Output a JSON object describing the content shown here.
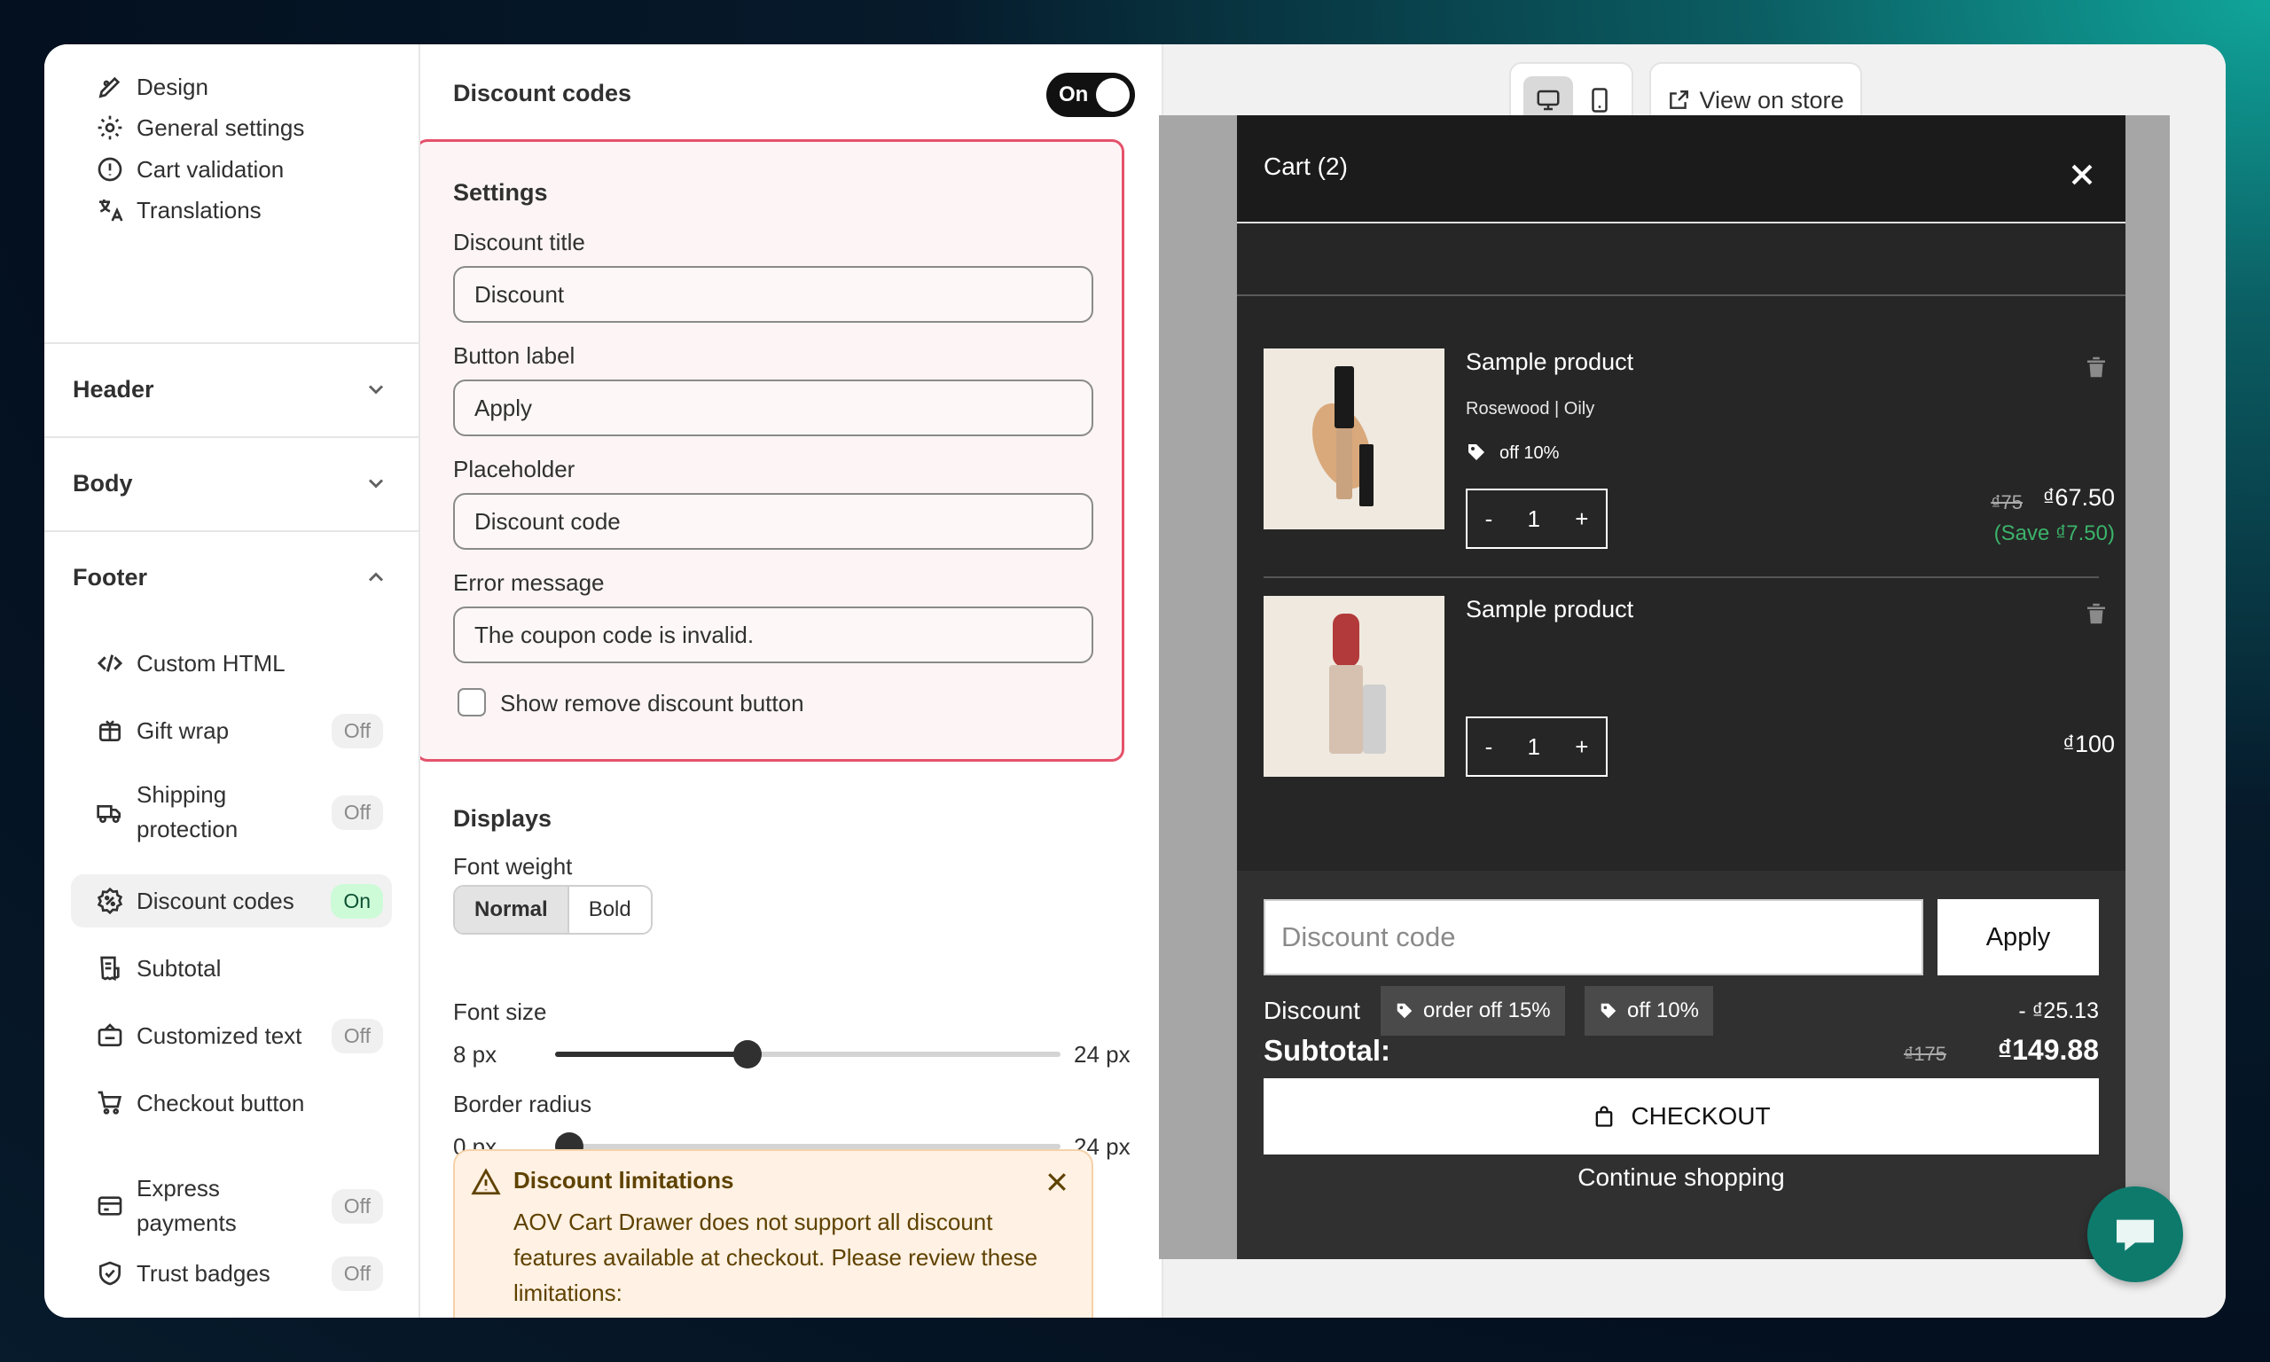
{
  "sidebar": {
    "items_top": [
      {
        "label": "Design",
        "icon": "design-icon"
      },
      {
        "label": "General settings",
        "icon": "gear-icon"
      },
      {
        "label": "Cart validation",
        "icon": "alert-circle-icon"
      },
      {
        "label": "Translations",
        "icon": "translate-icon"
      }
    ],
    "sections": {
      "header": "Header",
      "body": "Body",
      "footer": "Footer"
    },
    "footer_items": [
      {
        "label": "Custom HTML",
        "badge": ""
      },
      {
        "label": "Gift wrap",
        "badge": "Off"
      },
      {
        "label": "Shipping protection",
        "badge": "Off"
      },
      {
        "label": "Discount codes",
        "badge": "On"
      },
      {
        "label": "Subtotal",
        "badge": ""
      },
      {
        "label": "Customized text",
        "badge": "Off"
      },
      {
        "label": "Checkout button",
        "badge": ""
      },
      {
        "label": "Express payments",
        "badge": "Off"
      },
      {
        "label": "Trust badges",
        "badge": "Off"
      }
    ]
  },
  "settings": {
    "title": "Discount codes",
    "toggle": "On",
    "settings_heading": "Settings",
    "discount_title_label": "Discount title",
    "discount_title_value": "Discount",
    "button_label_label": "Button label",
    "button_label_value": "Apply",
    "placeholder_label": "Placeholder",
    "placeholder_value": "Discount code",
    "error_label": "Error message",
    "error_value": "The coupon code is invalid.",
    "show_remove_label": "Show remove discount button",
    "displays_heading": "Displays",
    "font_weight_label": "Font weight",
    "font_weight_options": [
      "Normal",
      "Bold"
    ],
    "font_weight_selected": "Normal",
    "font_size_label": "Font size",
    "font_size_min": "8 px",
    "font_size_max": "24 px",
    "font_size_level": 0.38,
    "border_radius_label": "Border radius",
    "border_radius_min": "0 px",
    "border_radius_max": "24 px",
    "border_radius_level": 0.0,
    "warning_title": "Discount limitations",
    "warning_text": "AOV Cart Drawer does not support all discount features available at checkout. Please review these limitations:"
  },
  "preview": {
    "view_on_store": "View on store",
    "cart_title": "Cart (2)",
    "products": [
      {
        "name": "Sample product",
        "variant": "Rosewood | Oily",
        "discount_tag": "off 10%",
        "qty": "1",
        "old_price": "₫75",
        "price": "₫67.50",
        "save": "(Save ₫7.50)"
      },
      {
        "name": "Sample product",
        "variant": "",
        "discount_tag": "",
        "qty": "1",
        "old_price": "",
        "price": "₫100",
        "save": ""
      }
    ],
    "qty_minus": "-",
    "qty_plus": "+",
    "discount_placeholder": "Discount code",
    "apply_label": "Apply",
    "discount_label": "Discount",
    "discount_tags": [
      "order off 15%",
      "off 10%"
    ],
    "discount_amount": "- ₫25.13",
    "subtotal_label": "Subtotal:",
    "subtotal_old": "₫175",
    "subtotal_value": "₫149.88",
    "checkout_label": "CHECKOUT",
    "continue_label": "Continue shopping"
  },
  "colors": {
    "accent_red": "#e5526b",
    "save_green": "#3bb36a",
    "on_badge": "#cdfbd8"
  }
}
